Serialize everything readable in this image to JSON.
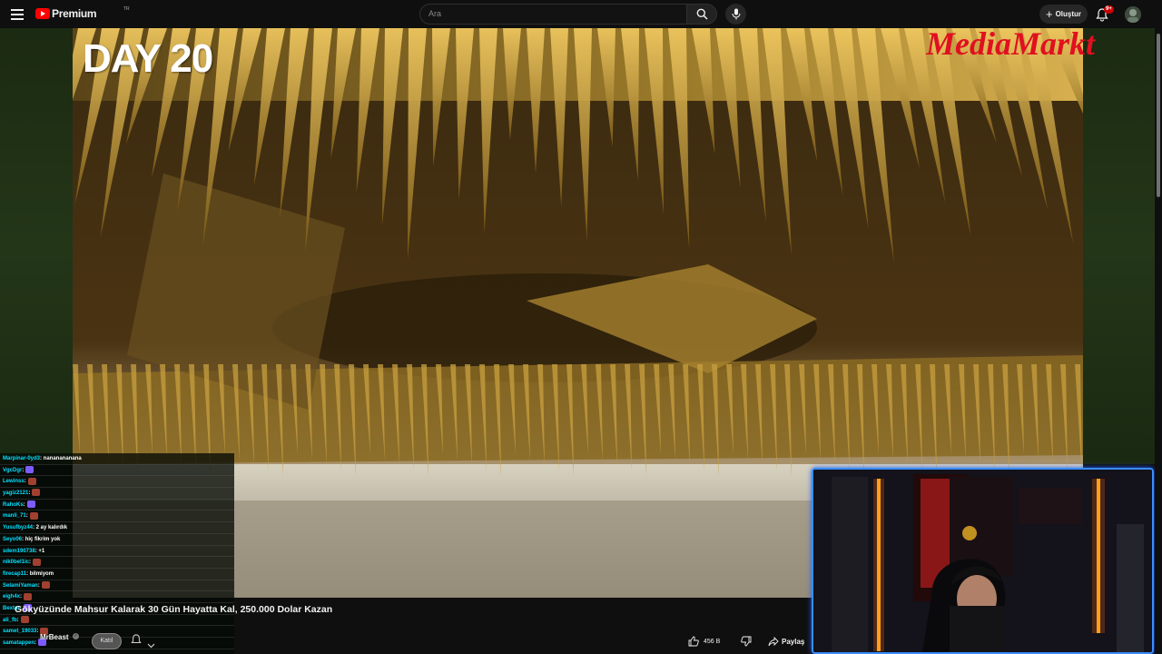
{
  "header": {
    "logo_text": "Premium",
    "logo_superscript": "TR",
    "search_placeholder": "Ara",
    "create_label": "Oluştur",
    "notifications_badge": "9+",
    "icons": [
      "menu-icon",
      "search-icon",
      "mic-icon",
      "plus-icon",
      "bell-icon"
    ]
  },
  "video": {
    "overlay_title": "DAY 20",
    "brand_logo": "MediaMarkt",
    "title_prefix": "Gökyüzünde Mahsur Kalarak 30 Gün Hayatta Kal, ",
    "title_suffix": "250.000 Dolar Kazan",
    "channel": "MrBeast",
    "join_label": "Katıl",
    "likes": "456 B",
    "share_label": "Paylaş"
  },
  "chat": {
    "messages": [
      {
        "user": "Marpinar-0yd3",
        "text": ": nananananana"
      },
      {
        "user": "VgcDgr",
        "text": ":"
      },
      {
        "user": "Lewinss",
        "text": ":"
      },
      {
        "user": "yagiz2121",
        "text": ":"
      },
      {
        "user": "RahoKs",
        "text": ":"
      },
      {
        "user": "manli_71",
        "text": ":"
      },
      {
        "user": "Yusufbyz44",
        "text": ": 2 ay kalırdık"
      },
      {
        "user": "Seyo06",
        "text": ": hiç fikrim yok"
      },
      {
        "user": "sdem190738",
        "text": ": +1"
      },
      {
        "user": "nik0bel1ic",
        "text": ":"
      },
      {
        "user": "firecap11",
        "text": ": bilmiyom"
      },
      {
        "user": "SelamiYaman",
        "text": ":"
      },
      {
        "user": "eigh4x",
        "text": ":"
      },
      {
        "user": "Bextar",
        "text": ":"
      },
      {
        "user": "ali_fb",
        "text": ":"
      },
      {
        "user": "samet_19033",
        "text": ":"
      },
      {
        "user": "samatappen",
        "text": ":"
      }
    ]
  },
  "colors": {
    "accent_red": "#ff0000",
    "webcam_border": "#3a8dff",
    "chat_name": "#00e0ff"
  }
}
